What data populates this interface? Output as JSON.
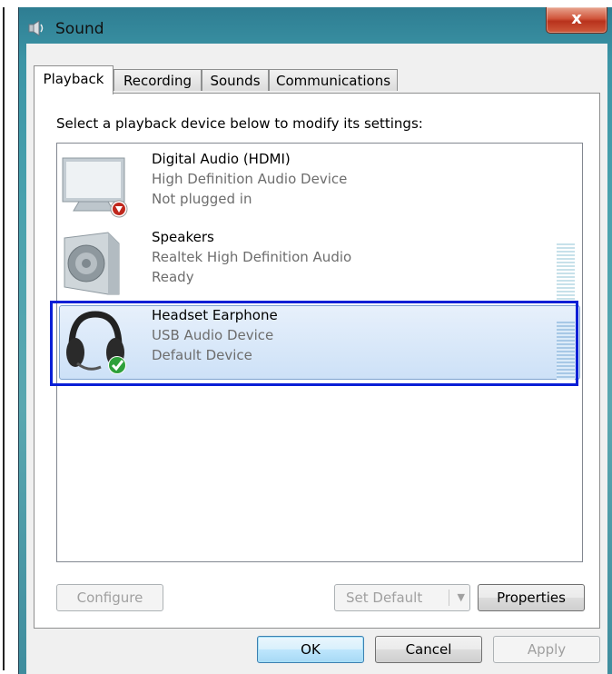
{
  "window": {
    "title": "Sound",
    "close_label": "x"
  },
  "tabs": [
    {
      "label": "Playback",
      "active": true
    },
    {
      "label": "Recording",
      "active": false
    },
    {
      "label": "Sounds",
      "active": false
    },
    {
      "label": "Communications",
      "active": false
    }
  ],
  "instruction": "Select a playback device below to modify its settings:",
  "devices": [
    {
      "name": "Digital Audio (HDMI)",
      "driver": "High Definition Audio Device",
      "status": "Not plugged in",
      "icon": "monitor-icon",
      "selected": false
    },
    {
      "name": "Speakers",
      "driver": "Realtek High Definition Audio",
      "status": "Ready",
      "icon": "speaker-icon",
      "selected": false
    },
    {
      "name": "Headset Earphone",
      "driver": "USB Audio Device",
      "status": "Default Device",
      "icon": "headset-icon",
      "selected": true
    }
  ],
  "panel_buttons": {
    "configure": "Configure",
    "set_default": "Set Default",
    "properties": "Properties"
  },
  "dialog_buttons": {
    "ok": "OK",
    "cancel": "Cancel",
    "apply": "Apply"
  },
  "colors": {
    "highlight_border": "#0a1fd6",
    "selection": "#cde1f7",
    "secondary_text": "#6d6d6d"
  }
}
